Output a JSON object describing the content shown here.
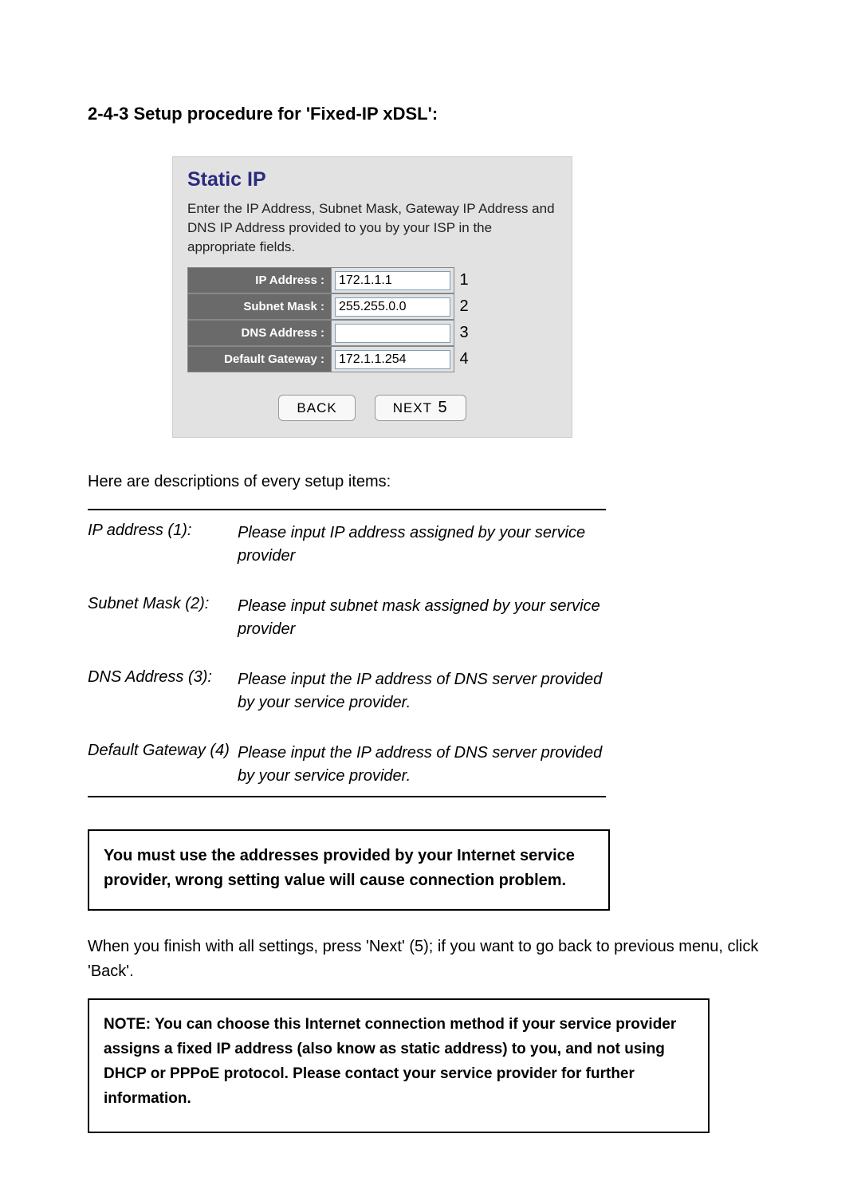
{
  "section_title": "2-4-3 Setup procedure for 'Fixed-IP xDSL':",
  "router": {
    "title": "Static IP",
    "desc": "Enter the IP Address, Subnet Mask, Gateway IP Address and DNS IP Address provided to you by your ISP in the appropriate fields.",
    "rows": [
      {
        "label": "IP Address :",
        "value": "172.1.1.1",
        "num": "1"
      },
      {
        "label": "Subnet Mask :",
        "value": "255.255.0.0",
        "num": "2"
      },
      {
        "label": "DNS Address :",
        "value": "",
        "num": "3"
      },
      {
        "label": "Default Gateway :",
        "value": "172.1.1.254",
        "num": "4"
      }
    ],
    "buttons": {
      "back": "BACK",
      "next": "NEXT",
      "next_num": "5"
    }
  },
  "intro_text": "Here are descriptions of every setup items:",
  "descriptions": [
    {
      "term": "IP address (1):",
      "def": "Please input IP address assigned by your service provider"
    },
    {
      "term": "Subnet Mask (2):",
      "def": "Please input subnet mask assigned by your service provider"
    },
    {
      "term": "DNS Address (3):",
      "def": "Please input the IP address of DNS server provided by your service provider."
    },
    {
      "term": "Default Gateway (4)",
      "def": "Please input the IP address of DNS server provided   by your service provider."
    }
  ],
  "warning": "You must use the addresses provided by your Internet service provider, wrong setting value will cause connection problem.",
  "body2": "When you finish with all settings, press 'Next' (5); if you want to go back to previous menu, click 'Back'.",
  "note": "NOTE: You can choose this Internet connection method if your service provider assigns a fixed IP address (also know as static address) to you, and not using DHCP or PPPoE protocol. Please contact your service provider for further information."
}
